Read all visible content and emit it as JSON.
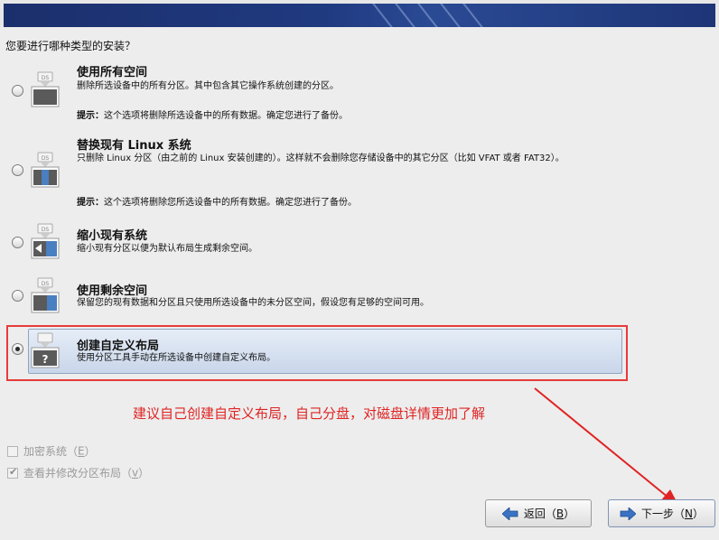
{
  "question": "您要进行哪种类型的安装？",
  "options": [
    {
      "title": "使用所有空间",
      "desc": "删除所选设备中的所有分区。其中包含其它操作系统创建的分区。",
      "tip_label": "提示：",
      "tip_text": "这个选项将删除所选设备中的所有数据。确定您进行了备份。",
      "icon": "drive-use-all-icon",
      "selected": false
    },
    {
      "title": "替换现有 Linux 系统",
      "desc": "只删除 Linux 分区（由之前的 Linux 安装创建的）。这样就不会删除您存储设备中的其它分区（比如 VFAT 或者 FAT32）。",
      "tip_label": "提示：",
      "tip_text": "这个选项将删除您所选设备中的所有数据。确定您进行了备份。",
      "icon": "drive-replace-linux-icon",
      "selected": false
    },
    {
      "title": "缩小现有系统",
      "desc": "缩小现有分区以便为默认布局生成剩余空间。",
      "icon": "drive-shrink-icon",
      "selected": false
    },
    {
      "title": "使用剩余空间",
      "desc": "保留您的现有数据和分区且只使用所选设备中的未分区空间，假设您有足够的空间可用。",
      "icon": "drive-free-space-icon",
      "selected": false
    },
    {
      "title": "创建自定义布局",
      "desc": "使用分区工具手动在所选设备中创建自定义布局。",
      "icon": "drive-custom-icon",
      "selected": true
    }
  ],
  "icon_badge": "DS",
  "custom_icon_glyph": "?",
  "annotation": "建议自己创建自定义布局，自己分盘，对磁盘详情更加了解",
  "checkboxes": [
    {
      "label": "加密系统（",
      "key": "E",
      "suffix": "）",
      "checked": false
    },
    {
      "label": "查看并修改分区布局（",
      "key": "v",
      "suffix": "）",
      "checked": true
    }
  ],
  "buttons": {
    "back": {
      "label": "返回（",
      "key": "B",
      "suffix": "）"
    },
    "next": {
      "label": "下一步（",
      "key": "N",
      "suffix": "）"
    }
  },
  "colors": {
    "annotation": "#e02424",
    "banner": "#203a80",
    "selection_panel": "#d4deef"
  }
}
